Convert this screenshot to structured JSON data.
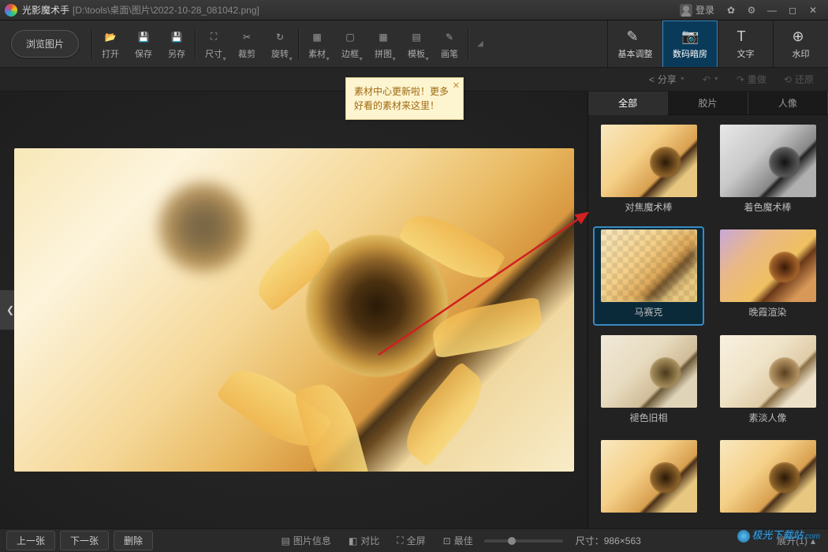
{
  "title": {
    "app": "光影魔术手",
    "path": "[D:\\tools\\桌面\\图片\\2022-10-28_081042.png]"
  },
  "login": {
    "label": "登录"
  },
  "toolbar": {
    "browse": "浏览图片",
    "items": [
      {
        "label": "打开",
        "icon": "📂"
      },
      {
        "label": "保存",
        "icon": "💾"
      },
      {
        "label": "另存",
        "icon": "💾"
      },
      {
        "label": "尺寸",
        "icon": "⛶",
        "dd": true
      },
      {
        "label": "裁剪",
        "icon": "✂"
      },
      {
        "label": "旋转",
        "icon": "↻",
        "dd": true
      },
      {
        "label": "素材",
        "icon": "▦",
        "dd": true
      },
      {
        "label": "边框",
        "icon": "▢",
        "dd": true
      },
      {
        "label": "拼图",
        "icon": "▦",
        "dd": true
      },
      {
        "label": "模板",
        "icon": "▤",
        "dd": true
      },
      {
        "label": "画笔",
        "icon": "✎"
      }
    ],
    "more": "◢"
  },
  "panels": [
    {
      "label": "基本调整",
      "icon": "✎"
    },
    {
      "label": "数码暗房",
      "icon": "📷",
      "active": true
    },
    {
      "label": "文字",
      "icon": "T"
    },
    {
      "label": "水印",
      "icon": "⊕"
    }
  ],
  "subbar": {
    "share": "分享",
    "undo": "↶",
    "redo": "重做",
    "restore": "还原"
  },
  "tooltip": {
    "text": "素材中心更新啦！更多好看的素材来这里！",
    "close": "✕"
  },
  "filterTabs": [
    "全部",
    "胶片",
    "人像"
  ],
  "filters": [
    {
      "label": "对焦魔术棒",
      "cls": "th-base"
    },
    {
      "label": "着色魔术棒",
      "cls": "th-bw"
    },
    {
      "label": "马赛克",
      "cls": "th-mosaic",
      "selected": true
    },
    {
      "label": "晚霞渲染",
      "cls": "th-sunset"
    },
    {
      "label": "褪色旧相",
      "cls": "th-faded"
    },
    {
      "label": "素淡人像",
      "cls": "th-pale"
    },
    {
      "label": "",
      "cls": "th-base"
    },
    {
      "label": "",
      "cls": "th-base"
    }
  ],
  "statusbar": {
    "prev": "上一张",
    "next": "下一张",
    "delete": "删除",
    "size": "尺寸：986×563",
    "info": "图片信息",
    "compare": "对比",
    "fullscreen": "全屏",
    "bestfit": "最佳",
    "expand": "展开(1)"
  },
  "watermark": "极光下载站"
}
